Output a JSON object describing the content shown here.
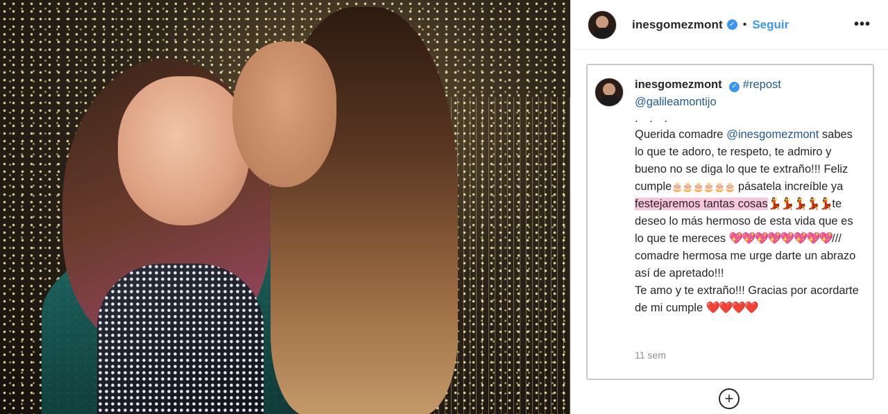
{
  "header": {
    "username": "inesgomezmont",
    "separator": "•",
    "follow_label": "Seguir",
    "more_label": "•••"
  },
  "caption": {
    "username": "inesgomezmont",
    "repost_tag": "#repost",
    "mention_source": "@galileamontijo",
    "ellipsis": ". . .",
    "text_1": "Querida comadre ",
    "mention_target": "@inesgomezmont",
    "text_2": " sabes lo que te adoro, te respeto, te admiro y bueno no se diga lo que te extraño!!! Feliz cumple",
    "cake_emojis": "🎂🎂🎂🎂🎂🎂",
    "text_3": " pásatela increíble ya ",
    "highlight": "festejaremos tantas cosas",
    "dancer_emojis": "💃💃💃💃💃",
    "text_4": "te deseo lo más hermoso de esta vida que es lo que te mereces ",
    "hearts_pink": "💖💖💖💖💖💖💖💖",
    "text_5": "/// comadre hermosa me urge darte un abrazo así de apretado!!!",
    "text_6": "Te amo y te extraño!!! Gracias por acordarte de mi cumple ",
    "hearts_red": "❤️❤️❤️❤️",
    "age": "11 sem"
  },
  "icons": {
    "verified": "verified-badge-icon",
    "add": "add-circle-icon",
    "more": "more-options-icon"
  },
  "colors": {
    "link_blue": "#3897f0",
    "mention_blue": "#1e5a8f",
    "highlight_pink": "#f9c6dd"
  }
}
